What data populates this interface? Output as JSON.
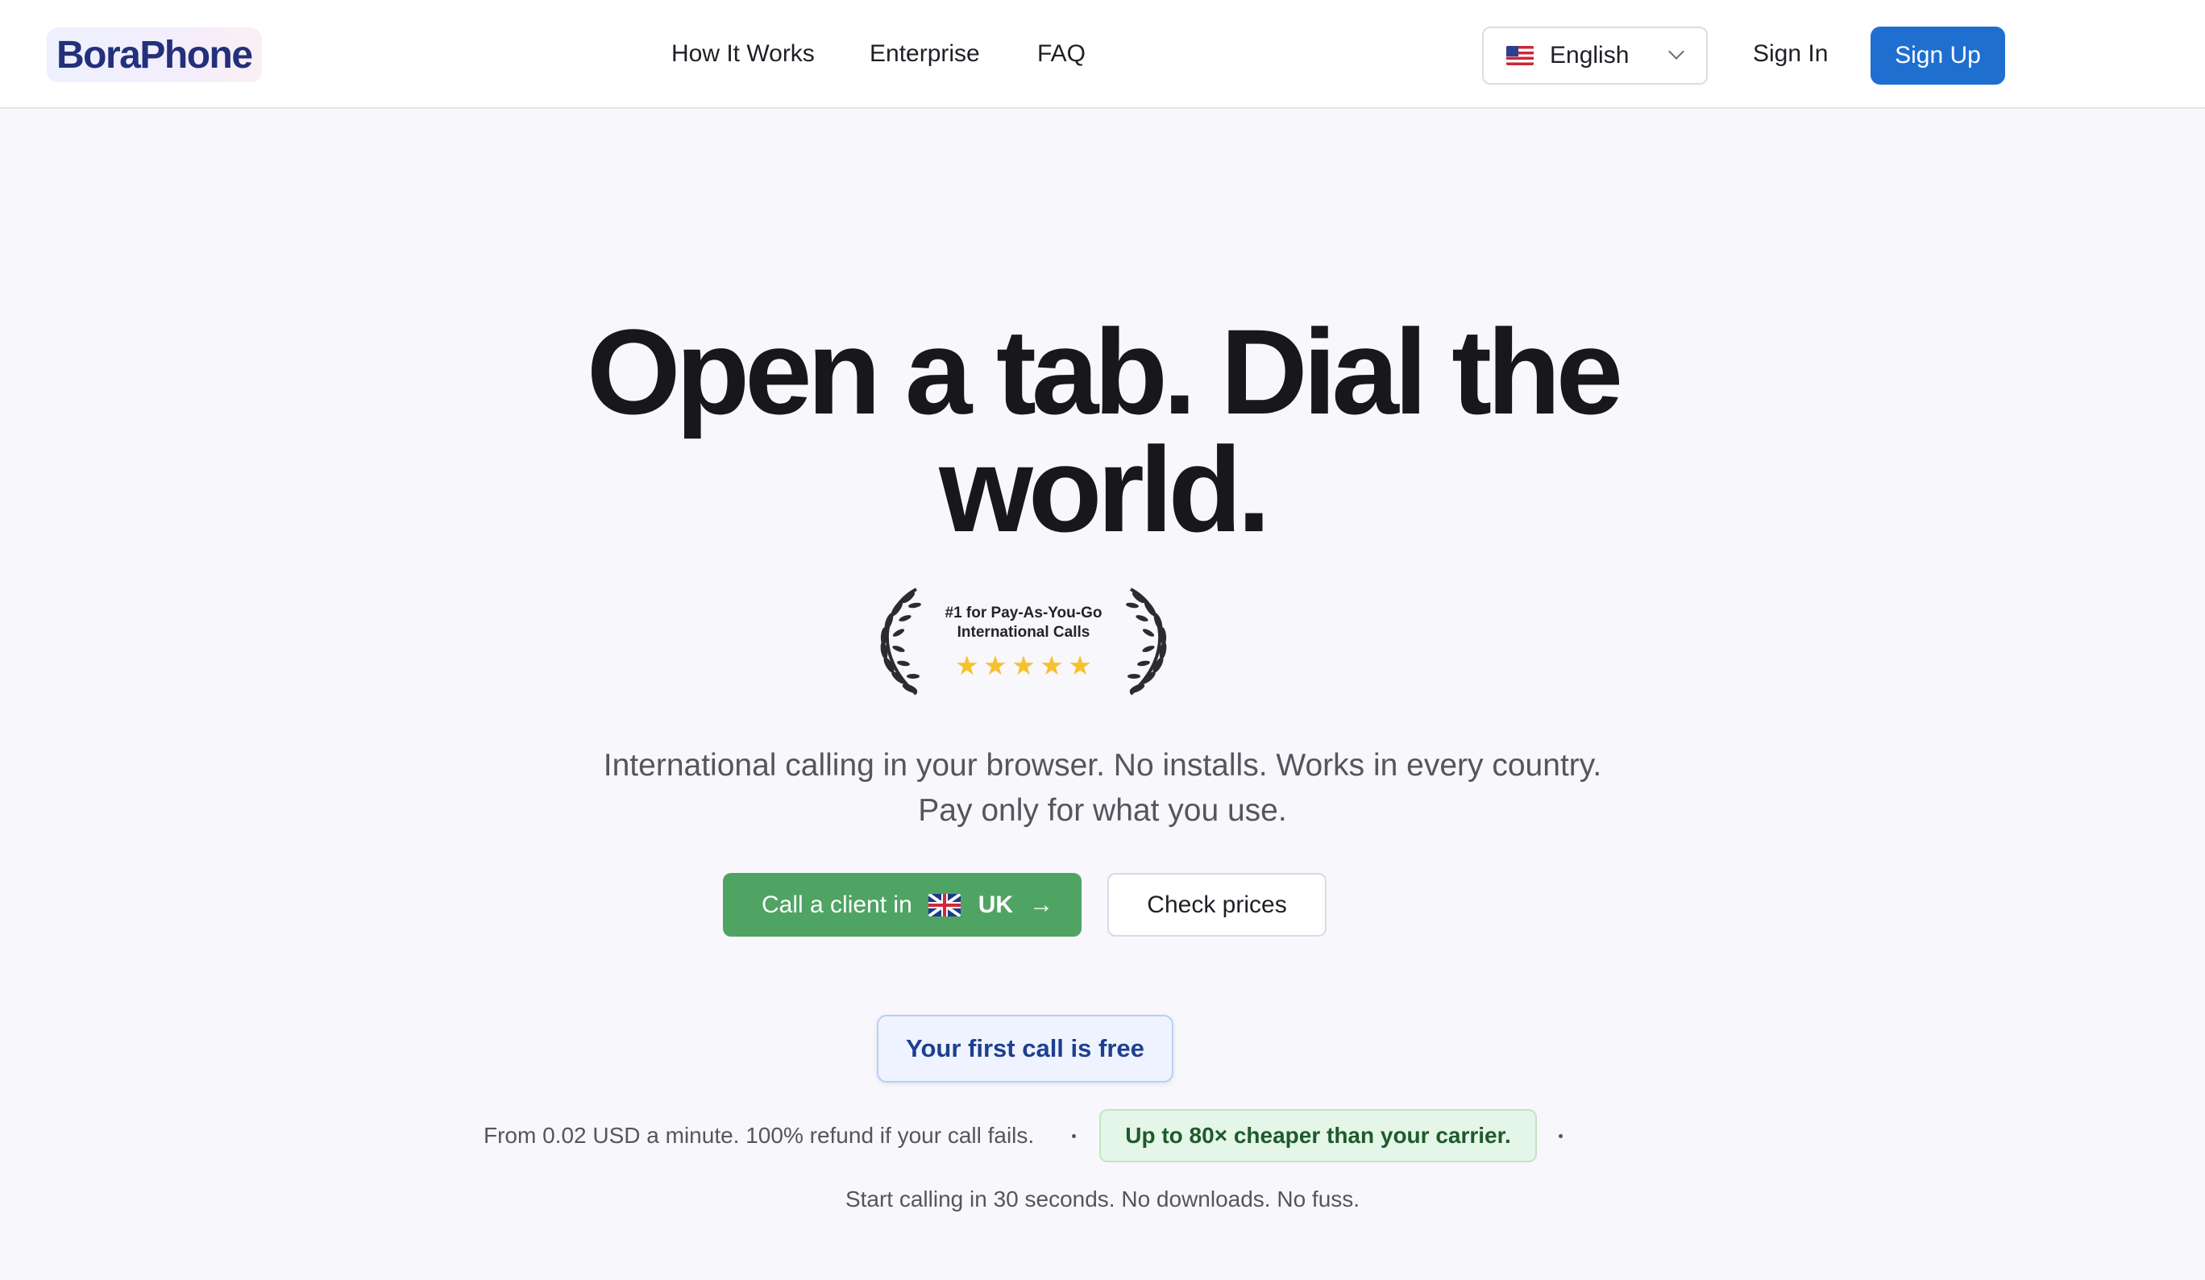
{
  "header": {
    "logo": "BoraPhone",
    "nav": [
      "How It Works",
      "Enterprise",
      "FAQ"
    ],
    "language": {
      "selected": "English",
      "flag_icon": "us-flag-icon"
    },
    "sign_in": "Sign In",
    "sign_up": "Sign Up"
  },
  "hero": {
    "title_line1": "Open a tab. Dial the",
    "title_line2": "world.",
    "award": {
      "line1": "#1 for Pay-As-You-Go",
      "line2": "International Calls",
      "stars": 5
    },
    "subtitle_line1": "International calling in your browser. No installs. Works in every country.",
    "subtitle_line2": "Pay only for what you use.",
    "cta_call": {
      "label": "Call a client in",
      "country": "UK",
      "flag_icon": "uk-flag-icon"
    },
    "cta_prices": "Check prices",
    "free_badge": "Your first call is free",
    "pricing_text": "From 0.02 USD a minute. 100% refund if your call fails.",
    "cheaper_badge": "Up to 80× cheaper than your carrier.",
    "start_text": "Start calling in 30 seconds. No downloads. No fuss."
  },
  "colors": {
    "brand_blue": "#1f6fd1",
    "cta_green": "#4fa464",
    "star_gold": "#f5c12e",
    "logo_navy": "#23307a"
  }
}
